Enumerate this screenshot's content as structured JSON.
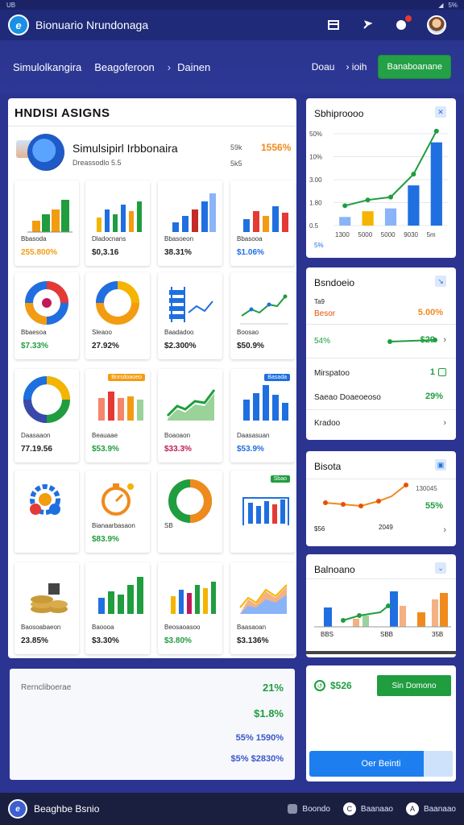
{
  "status": {
    "left": "UB",
    "right": "5%"
  },
  "app": {
    "title": "Bionuario Nrundonaga"
  },
  "nav": {
    "crumb1": "Simulolkangira",
    "crumb2": "Beagoferoon",
    "crumb3": "Dainen",
    "link1": "Doau",
    "link2": "ioih",
    "button": "Banaboanane"
  },
  "main": {
    "title": "HNDISI ASIGNS",
    "hero": {
      "name": "Simulsipirl Irbbonaira",
      "sub": "Dreassodlo 5.5",
      "k1": "59k",
      "k2": "5k5",
      "pct": "1556%"
    },
    "tiles": [
      {
        "label": "Bbasoda",
        "value": "255.800%",
        "color": "#f39c12"
      },
      {
        "label": "Dladocnans",
        "value": "$0,3.16",
        "color": "#222"
      },
      {
        "label": "Bbasoeon",
        "value": "38.31%",
        "color": "#222"
      },
      {
        "label": "Bbasooa",
        "value": "$1.06%",
        "color": "#1f6fe0"
      },
      {
        "label": "Bbaesoa",
        "value": "$7.33%",
        "color": "#1f9d3f"
      },
      {
        "label": "Sleaoo",
        "value": "27.92%",
        "color": "#222"
      },
      {
        "label": "Baadadoo",
        "value": "$2.300%",
        "color": "#222"
      },
      {
        "label": "Boosao",
        "value": "$50.9%",
        "color": "#222"
      },
      {
        "label": "Daasaaon",
        "value": "77.19.56",
        "color": "#222",
        "badge": ""
      },
      {
        "label": "Beauaae",
        "value": "$53.9%",
        "color": "#1f9d3f",
        "badge": "Bnrsdoaoeo"
      },
      {
        "label": "Boaoaon",
        "value": "$33.3%",
        "color": "#c2185b"
      },
      {
        "label": "Daasasuan",
        "value": "$53.9%",
        "color": "#1f6fe0",
        "badge": "Basada"
      },
      {
        "label": "",
        "value": "",
        "color": "#222"
      },
      {
        "label": "Bianaarbasaon",
        "value": "$83.9%",
        "color": "#1f9d3f"
      },
      {
        "label": "SB",
        "value": "",
        "color": "#222"
      },
      {
        "label": "",
        "value": "",
        "color": "#222",
        "badge": "Sbao"
      },
      {
        "label": "Baosoabaeon",
        "value": "23.85%",
        "color": "#222"
      },
      {
        "label": "Baoooa",
        "value": "$3.30%",
        "color": "#222"
      },
      {
        "label": "Beosaoasoo",
        "value": "$3.80%",
        "color": "#1f9d3f"
      },
      {
        "label": "Baasaoan",
        "value": "$3.136%",
        "color": "#222"
      }
    ],
    "summary": {
      "label": "Rerncliboerae",
      "v1": "21%",
      "v2": "$1.8%",
      "v3": "55% 1590%",
      "v4": "$5% $2830%"
    }
  },
  "side": {
    "card1": {
      "title": "Sbhiproooo",
      "y_ticks": [
        "50%",
        "10%",
        "3.00",
        "1.80",
        "0.5"
      ],
      "x_ticks": [
        "1300",
        "5000",
        "5000",
        "9030",
        "5m"
      ],
      "footer": "5%"
    },
    "card2": {
      "title": "Bsndoeio",
      "rows": [
        {
          "label": "Ta9",
          "value": ""
        },
        {
          "label": "Besor",
          "value": "5.00%"
        },
        {
          "label": "54%",
          "value": "$29"
        },
        {
          "label": "Mirspatoo",
          "value": "1"
        },
        {
          "label": "Saeao Doaeoeoso",
          "value": "29%"
        },
        {
          "label": "Kradoo",
          "value": ""
        }
      ]
    },
    "card3": {
      "title": "Bisota",
      "legend": "130045",
      "value": "55%",
      "foot1": "$56",
      "foot2": "2049"
    },
    "card4": {
      "title": "Balnoano",
      "x_ticks": [
        "BBS",
        "SBB",
        "35B"
      ]
    },
    "card5": {
      "value": "$526",
      "button": "Sin Domono",
      "bottom_button": "Oer Beinti"
    }
  },
  "bottom": {
    "title": "Beaghbe Bsnio",
    "item1": "Boondo",
    "item2": "Baanaao",
    "item3": "Baanaao"
  },
  "colors": {
    "accent": "#1f6fe0",
    "green": "#1f9d3f",
    "orange": "#f08a1c",
    "bg": "#2b3490"
  },
  "chart_data": [
    {
      "type": "bar",
      "categories": [
        "1300",
        "5000",
        "5000",
        "9030",
        "5m"
      ],
      "series": [
        {
          "name": "",
          "values": [
            0.3,
            0.5,
            0.6,
            1.4,
            2.9
          ]
        }
      ],
      "ylim": [
        0,
        3.2
      ]
    }
  ]
}
